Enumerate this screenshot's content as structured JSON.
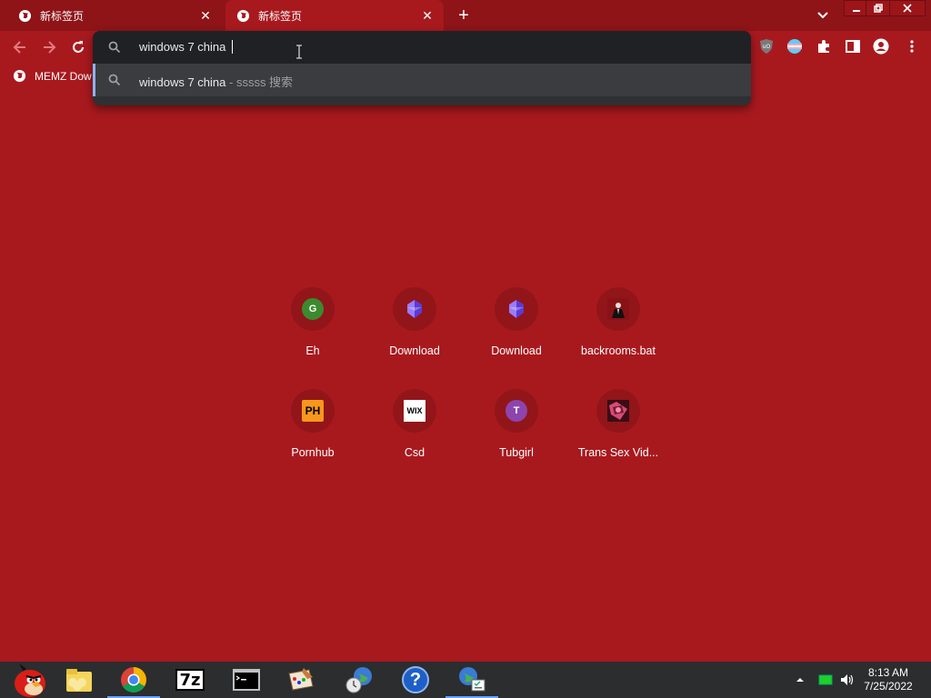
{
  "tabs": [
    {
      "title": "新标签页",
      "active": false
    },
    {
      "title": "新标签页",
      "active": true
    }
  ],
  "omnibox": {
    "input_value": "windows 7 china ",
    "suggestion": {
      "query": "windows 7 china",
      "description": " - sssss 搜索"
    }
  },
  "bookmarks": [
    {
      "label": "MEMZ Dow"
    }
  ],
  "shortcuts": [
    {
      "label": "Eh",
      "icon": "letter-g-icon",
      "letter": "G",
      "color": "#3c8a2e"
    },
    {
      "label": "Download",
      "icon": "purple-cube-icon"
    },
    {
      "label": "Download",
      "icon": "purple-cube-icon"
    },
    {
      "label": "backrooms.bat",
      "icon": "figure-icon"
    },
    {
      "label": "Pornhub",
      "icon": "ph-logo-icon",
      "letter": "PH"
    },
    {
      "label": "Csd",
      "icon": "wix-logo-icon",
      "letter": "WIX"
    },
    {
      "label": "Tubgirl",
      "icon": "letter-t-icon",
      "letter": "T",
      "color": "#8e44ad"
    },
    {
      "label": "Trans Sex Vid...",
      "icon": "thumbnail-icon"
    }
  ],
  "taskbar": {
    "apps": [
      "angry-bird-icon",
      "file-explorer-icon",
      "chrome-icon",
      "7zip-icon",
      "cmd-icon",
      "paint-icon",
      "clock-globe-icon",
      "help-icon",
      "network-icon"
    ],
    "seven_zip_label": "7z",
    "help_label": "?"
  },
  "clock": {
    "time": "8:13 AM",
    "date": "7/25/2022"
  },
  "colors": {
    "background": "#a8191e",
    "tabstrip": "#8e1418",
    "omnibox": "#202124",
    "taskbar": "#2c2d2f"
  }
}
